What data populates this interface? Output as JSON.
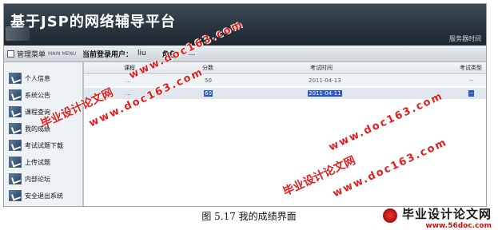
{
  "header": {
    "title": "基于JSP的网络辅导平台",
    "server_time_label": "服务器时间"
  },
  "menu": {
    "label": "管理菜单",
    "sublabel": "MAIN MENU"
  },
  "userbar": {
    "user_label": "当前登录用户：",
    "user_value": "liu",
    "role_label": "角色：",
    "role_value": "..."
  },
  "sidebar": {
    "items": [
      {
        "label": "个人信息"
      },
      {
        "label": "系统公告"
      },
      {
        "label": "课程查询"
      },
      {
        "label": "我的成绩"
      },
      {
        "label": "考试试题下载"
      },
      {
        "label": "上传试题"
      },
      {
        "label": "内部论坛"
      },
      {
        "label": "安全退出系统"
      }
    ]
  },
  "table": {
    "columns": [
      "课程",
      "分数",
      "考试时间",
      "考试类型"
    ],
    "rows": [
      {
        "course": "...",
        "score": "50",
        "time": "2011-04-13",
        "type": "--"
      },
      {
        "course": "...",
        "score": "60",
        "time": "2011-04-11",
        "type": "--"
      }
    ]
  },
  "watermarks": {
    "cn": "毕业设计论文网",
    "url": "www.doc163.com"
  },
  "caption": "图 5.17 我的成绩界面",
  "logo": {
    "cn": "毕业设计论文网",
    "url": "www.56doc.com"
  }
}
